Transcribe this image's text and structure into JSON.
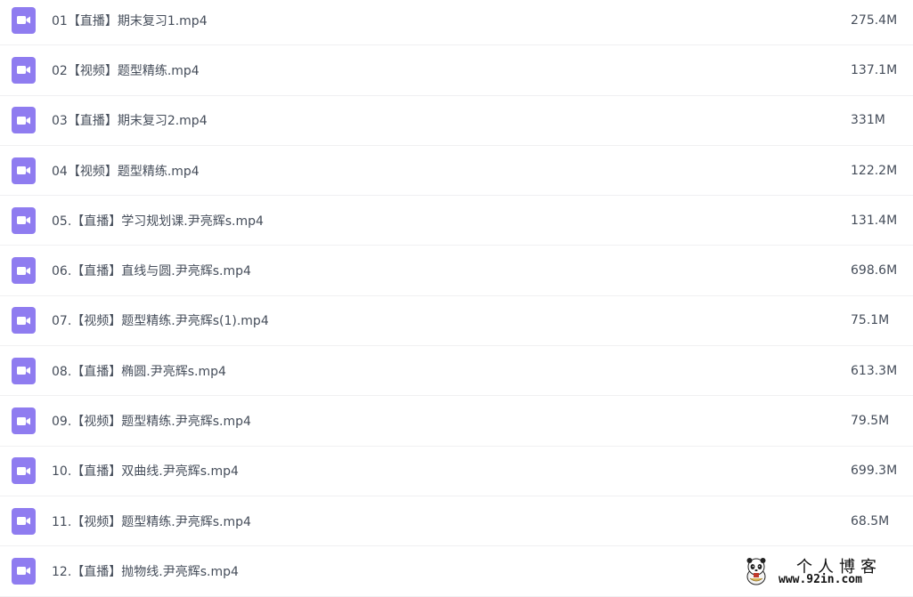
{
  "files": [
    {
      "name": "01【直播】期末复习1.mp4",
      "size": "275.4M",
      "icon": "video-file-icon"
    },
    {
      "name": "02【视频】题型精练.mp4",
      "size": "137.1M",
      "icon": "video-file-icon"
    },
    {
      "name": "03【直播】期末复习2.mp4",
      "size": "331M",
      "icon": "video-file-icon"
    },
    {
      "name": "04【视频】题型精练.mp4",
      "size": "122.2M",
      "icon": "video-file-icon"
    },
    {
      "name": "05.【直播】学习规划课.尹亮辉s.mp4",
      "size": "131.4M",
      "icon": "video-file-icon"
    },
    {
      "name": "06.【直播】直线与圆.尹亮辉s.mp4",
      "size": "698.6M",
      "icon": "video-file-icon"
    },
    {
      "name": "07.【视频】题型精练.尹亮辉s(1).mp4",
      "size": "75.1M",
      "icon": "video-file-icon"
    },
    {
      "name": "08.【直播】椭圆.尹亮辉s.mp4",
      "size": "613.3M",
      "icon": "video-file-icon"
    },
    {
      "name": "09.【视频】题型精练.尹亮辉s.mp4",
      "size": "79.5M",
      "icon": "video-file-icon"
    },
    {
      "name": "10.【直播】双曲线.尹亮辉s.mp4",
      "size": "699.3M",
      "icon": "video-file-icon"
    },
    {
      "name": "11.【视频】题型精练.尹亮辉s.mp4",
      "size": "68.5M",
      "icon": "video-file-icon"
    },
    {
      "name": "12.【直播】抛物线.尹亮辉s.mp4",
      "size": "",
      "icon": "video-file-icon"
    }
  ],
  "colors": {
    "icon_bg": "#8f7cf0",
    "text": "#454d5a",
    "divider": "#f0f0f2"
  },
  "watermark": {
    "title": "个人博客",
    "url": "www.92in.com"
  }
}
